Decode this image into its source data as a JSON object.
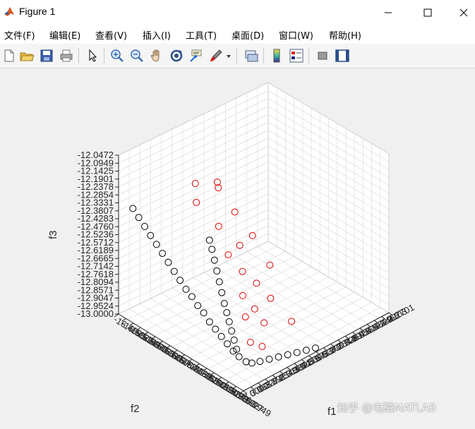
{
  "window": {
    "title": "Figure 1",
    "controls": [
      "minimize",
      "maximize",
      "close"
    ]
  },
  "menu": {
    "items": [
      "文件(F)",
      "编辑(E)",
      "查看(V)",
      "插入(I)",
      "工具(T)",
      "桌面(D)",
      "窗口(W)",
      "帮助(H)"
    ]
  },
  "toolbar": {
    "buttons": [
      "new-figure-icon",
      "open-file-icon",
      "save-icon",
      "print-icon",
      "edit-plot-arrow-icon",
      "zoom-in-icon",
      "zoom-out-icon",
      "pan-hand-icon",
      "rotate-3d-icon",
      "data-cursor-icon",
      "brush-icon",
      "link-plot-icon",
      "colorbar-icon",
      "legend-icon",
      "hide-plot-tools-icon",
      "show-plot-tools-icon"
    ]
  },
  "colors": {
    "series_black": "#000000",
    "series_red": "#e00000",
    "pane": "#ffffff",
    "grid": "#dcdcdc"
  },
  "watermark": "知乎 @电磁MATLAB",
  "chart_data": {
    "type": "scatter",
    "title": "",
    "xlabel": "f1",
    "ylabel": "f2",
    "zlabel": "f3",
    "marker": "open-circle",
    "grid": true,
    "view": "3d",
    "zlim": [
      -13.0,
      -12.0472
    ],
    "z_ticks": [
      "-12.0472",
      "-12.0949",
      "-12.1425",
      "-12.1901",
      "-12.2378",
      "-12.2854",
      "-12.3331",
      "-12.3807",
      "-12.4283",
      "-12.4760",
      "-12.5236",
      "-12.5712",
      "-12.6189",
      "-12.6665",
      "-12.7142",
      "-12.7618",
      "-12.8094",
      "-12.8571",
      "-12.9047",
      "-12.9524",
      "-13.0000"
    ],
    "y_ticks": [
      "-16.4695",
      "-16.5022",
      "-16.5349",
      "-16.5676",
      "-16.6003",
      "-16.6330",
      "-16.6657",
      "-16.6984",
      "-16.7311",
      "-16.7638",
      "-16.7965",
      "-16.8292",
      "-16.8619",
      "-16.8946",
      "-16.9273",
      "-16.9600",
      "-16.9927",
      "-16.9949"
    ],
    "x_ticks": [
      "3.0000",
      "3.0637",
      "3.1274",
      "3.1911",
      "3.2548",
      "3.3185",
      "3.3822",
      "3.4459",
      "3.5096",
      "3.5733",
      "3.6370",
      "3.7007",
      "3.7644",
      "3.8281",
      "3.8918",
      "3.9555",
      "4.0192",
      "4.0829",
      "4.1466",
      "4.2103",
      "4.2701"
    ],
    "xlim": [
      3.0,
      4.2701
    ],
    "ylim": [
      -16.9949,
      -16.4695
    ],
    "series": [
      {
        "color": "#000000",
        "points": [
          [
            3.02,
            -16.52,
            -12.33
          ],
          [
            3.03,
            -16.54,
            -12.37
          ],
          [
            3.04,
            -16.56,
            -12.41
          ],
          [
            3.05,
            -16.58,
            -12.45
          ],
          [
            3.06,
            -16.6,
            -12.49
          ],
          [
            3.07,
            -16.62,
            -12.53
          ],
          [
            3.08,
            -16.64,
            -12.57
          ],
          [
            3.09,
            -16.66,
            -12.61
          ],
          [
            3.1,
            -16.68,
            -12.65
          ],
          [
            3.11,
            -16.7,
            -12.69
          ],
          [
            3.12,
            -16.72,
            -12.72
          ],
          [
            3.13,
            -16.74,
            -12.76
          ],
          [
            3.14,
            -16.76,
            -12.79
          ],
          [
            3.15,
            -16.78,
            -12.83
          ],
          [
            3.16,
            -16.8,
            -12.86
          ],
          [
            3.17,
            -16.82,
            -12.89
          ],
          [
            3.18,
            -16.84,
            -12.92
          ],
          [
            3.19,
            -16.86,
            -12.95
          ],
          [
            3.2,
            -16.88,
            -12.97
          ],
          [
            3.22,
            -16.9,
            -12.99
          ],
          [
            3.25,
            -16.91,
            -13.0
          ],
          [
            3.3,
            -16.92,
            -13.0
          ],
          [
            3.36,
            -16.93,
            -13.0
          ],
          [
            3.42,
            -16.94,
            -13.0
          ],
          [
            3.48,
            -16.95,
            -13.0
          ],
          [
            3.54,
            -16.96,
            -13.0
          ],
          [
            3.6,
            -16.97,
            -13.0
          ],
          [
            3.66,
            -16.98,
            -13.0
          ],
          [
            3.22,
            -16.86,
            -12.95
          ],
          [
            3.24,
            -16.84,
            -12.92
          ],
          [
            3.26,
            -16.82,
            -12.89
          ],
          [
            3.28,
            -16.8,
            -12.86
          ],
          [
            3.3,
            -16.78,
            -12.83
          ],
          [
            3.32,
            -16.76,
            -12.8
          ],
          [
            3.34,
            -16.74,
            -12.76
          ],
          [
            3.36,
            -16.72,
            -12.72
          ],
          [
            3.38,
            -16.7,
            -12.68
          ],
          [
            3.4,
            -16.68,
            -12.64
          ],
          [
            3.42,
            -16.66,
            -12.6
          ],
          [
            3.44,
            -16.64,
            -12.57
          ]
        ]
      },
      {
        "color": "#e00000",
        "points": [
          [
            3.4,
            -16.6,
            -12.25
          ],
          [
            3.55,
            -16.62,
            -12.28
          ],
          [
            3.45,
            -16.58,
            -12.4
          ],
          [
            3.6,
            -16.6,
            -12.35
          ],
          [
            3.5,
            -16.65,
            -12.5
          ],
          [
            3.62,
            -16.66,
            -12.45
          ],
          [
            3.48,
            -16.7,
            -12.62
          ],
          [
            3.58,
            -16.7,
            -12.6
          ],
          [
            3.65,
            -16.72,
            -12.55
          ],
          [
            3.52,
            -16.74,
            -12.7
          ],
          [
            3.44,
            -16.78,
            -12.78
          ],
          [
            3.56,
            -16.78,
            -12.75
          ],
          [
            3.38,
            -16.82,
            -12.85
          ],
          [
            3.6,
            -16.82,
            -12.82
          ],
          [
            3.46,
            -16.86,
            -12.88
          ],
          [
            3.3,
            -16.88,
            -12.92
          ],
          [
            3.36,
            -16.9,
            -12.95
          ],
          [
            3.7,
            -16.86,
            -12.96
          ],
          [
            4.05,
            -16.6,
            -12.98
          ],
          [
            3.42,
            -16.84,
            -12.8
          ]
        ]
      }
    ]
  }
}
